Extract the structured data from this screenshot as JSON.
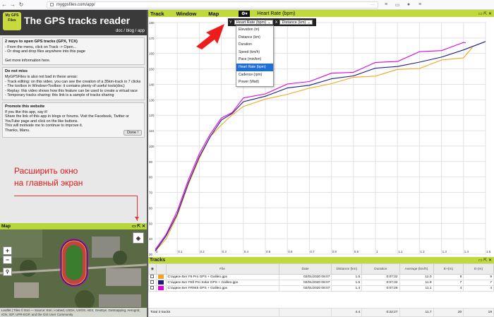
{
  "browser": {
    "url": "mygpsfiles.com/app/",
    "back_icon": "back-arrow-icon",
    "forward_icon": "forward-arrow-icon"
  },
  "header": {
    "logo_text": "My GPS Files",
    "title": "The GPS tracks reader",
    "links": "doc / blog / app"
  },
  "info_boxes": [
    {
      "title": "2 ways to open GPS tracks (GPX, TCX)",
      "lines": [
        "- From the menu, click on Track -> Open...",
        "- Or drag and drop files anywhere into this page",
        "",
        "Get more information here."
      ]
    },
    {
      "title": "Do not miss",
      "lines": [
        "MyGPSFiles is also not bad in these areas:",
        "- Track editing: on this video, you can see the creation of a 35km-track in 7 clicks",
        "- The toolbox in Window>Toolbox: it contains plenty of useful tools(doc)",
        "- Replay: this video shows how this feature can be used to create a virtual race",
        "- Temporary tracks sharing: this link is a sample of tracks sharing"
      ]
    },
    {
      "title": "Promote this website",
      "lines": [
        "If you like this app, say it!",
        "Share the link of this app in blogs or forums. Visit the Facebook, Twitter or YouTube page and click on the like buttons.",
        "This will motivate me to continue to improve it.",
        "Thanks, Manu."
      ],
      "button": "Done !"
    }
  ],
  "annotation": {
    "line1": "Расширить окно",
    "line2": "на главный экран"
  },
  "map": {
    "title": "Map",
    "zoom_in": "+",
    "zoom_out": "−",
    "attribution": "Leaflet | Tiles © Esri — Source: Esri, i-cubed, USDA, USGS, AEX, GeoEye, Getmapping, Aerogrid, IGN, IGP, UPR-EGP, and the GIS User Community"
  },
  "chart_window": {
    "menus": [
      "Track",
      "Window",
      "Map"
    ],
    "chart_name": "Heart Rate (bpm)",
    "y_label": "Y",
    "y_selected": "Heart Rate (bpm)",
    "x_label": "X",
    "x_selected": "Distance (km)",
    "y_options": [
      "Elevation (m)",
      "Distance (km)",
      "Duration",
      "Speed (km/h)",
      "Pace (min/km)",
      "Heart Rate (bpm)",
      "Cadence (rpm)",
      "Power (Watt)"
    ],
    "y_options_active_index": 5
  },
  "chart_data": {
    "type": "line",
    "title": "Heart Rate (bpm)",
    "xlabel": "",
    "ylabel": "",
    "xlim": [
      0,
      1.5
    ],
    "ylim": [
      30,
      180
    ],
    "x_ticks": [
      "0",
      "0.1",
      "0.2",
      "0.3",
      "0.4",
      "0.5",
      "0.6",
      "0.7",
      "0.8",
      "0.9",
      "1",
      "1.1",
      "1.2",
      "1.3",
      "1.4",
      "1.5"
    ],
    "y_ticks": [
      "30",
      "40",
      "50",
      "60",
      "70",
      "80",
      "90",
      "100",
      "110",
      "120",
      "130",
      "140",
      "150",
      "160",
      "170",
      "180"
    ],
    "grid": true,
    "series": [
      {
        "color": "#f2a51d",
        "x": [
          0,
          0.05,
          0.1,
          0.15,
          0.2,
          0.25,
          0.3,
          0.35,
          0.4,
          0.5,
          0.6,
          0.7,
          0.8,
          0.9,
          1.0,
          1.1,
          1.2,
          1.3,
          1.4,
          1.44
        ],
        "y": [
          32,
          40,
          55,
          75,
          92,
          106,
          114,
          120,
          126,
          130,
          134,
          137,
          141,
          144,
          146,
          149,
          151,
          155,
          158,
          163
        ]
      },
      {
        "color": "#1a1a80",
        "x": [
          0,
          0.05,
          0.1,
          0.15,
          0.2,
          0.25,
          0.3,
          0.35,
          0.4,
          0.5,
          0.6,
          0.7,
          0.8,
          0.9,
          1.0,
          1.1,
          1.2,
          1.3,
          1.4,
          1.5
        ],
        "y": [
          32,
          42,
          56,
          76,
          93,
          107,
          116,
          122,
          128,
          133,
          137,
          140,
          143,
          146,
          150,
          152,
          154,
          158,
          162,
          168
        ]
      },
      {
        "color": "#e000e0",
        "x": [
          0,
          0.05,
          0.1,
          0.15,
          0.2,
          0.25,
          0.3,
          0.35,
          0.4,
          0.5,
          0.6,
          0.7,
          0.8,
          0.9,
          1.0,
          1.1,
          1.2,
          1.3,
          1.4,
          1.41
        ],
        "y": [
          33,
          43,
          58,
          78,
          95,
          109,
          117,
          123,
          130,
          135,
          139,
          143,
          146,
          149,
          153,
          156,
          160,
          163,
          166,
          168
        ]
      }
    ]
  },
  "tracks": {
    "title": "Tracks",
    "columns": [
      "File",
      "Date",
      "Distance (km)",
      "Duration",
      "Average (km/h)",
      "E+(m)",
      "E-(m)"
    ],
    "rows": [
      {
        "color": "#f2a51d",
        "file": "Стадион Бег F6 Pro GPS + Galileo.gpx",
        "date": "02/01/2020 08:07",
        "distance": "1.5",
        "duration": "0:07:32",
        "average": "12.0",
        "eplus": "9",
        "eminus": "9"
      },
      {
        "color": "#1a1a80",
        "file": "Стадион Бег FEll Pro Solar GPS + Galileo.gpx",
        "date": "02/01/2020 08:07",
        "distance": "1.5",
        "duration": "0:07:32",
        "average": "11.9",
        "eplus": "7",
        "eminus": "7"
      },
      {
        "color": "#e000e0",
        "file": "Стадион Бег FR945 GPS + Galileo.gpx",
        "date": "02/01/2020 08:07",
        "distance": "1.4",
        "duration": "0:07:28",
        "average": "11.1",
        "eplus": "4",
        "eminus": "4"
      }
    ],
    "total": {
      "label": "Total 3 tracks",
      "distance": "4.4",
      "duration": "0:22:27",
      "average": "11.7",
      "eplus": "20",
      "eminus": "19"
    }
  }
}
